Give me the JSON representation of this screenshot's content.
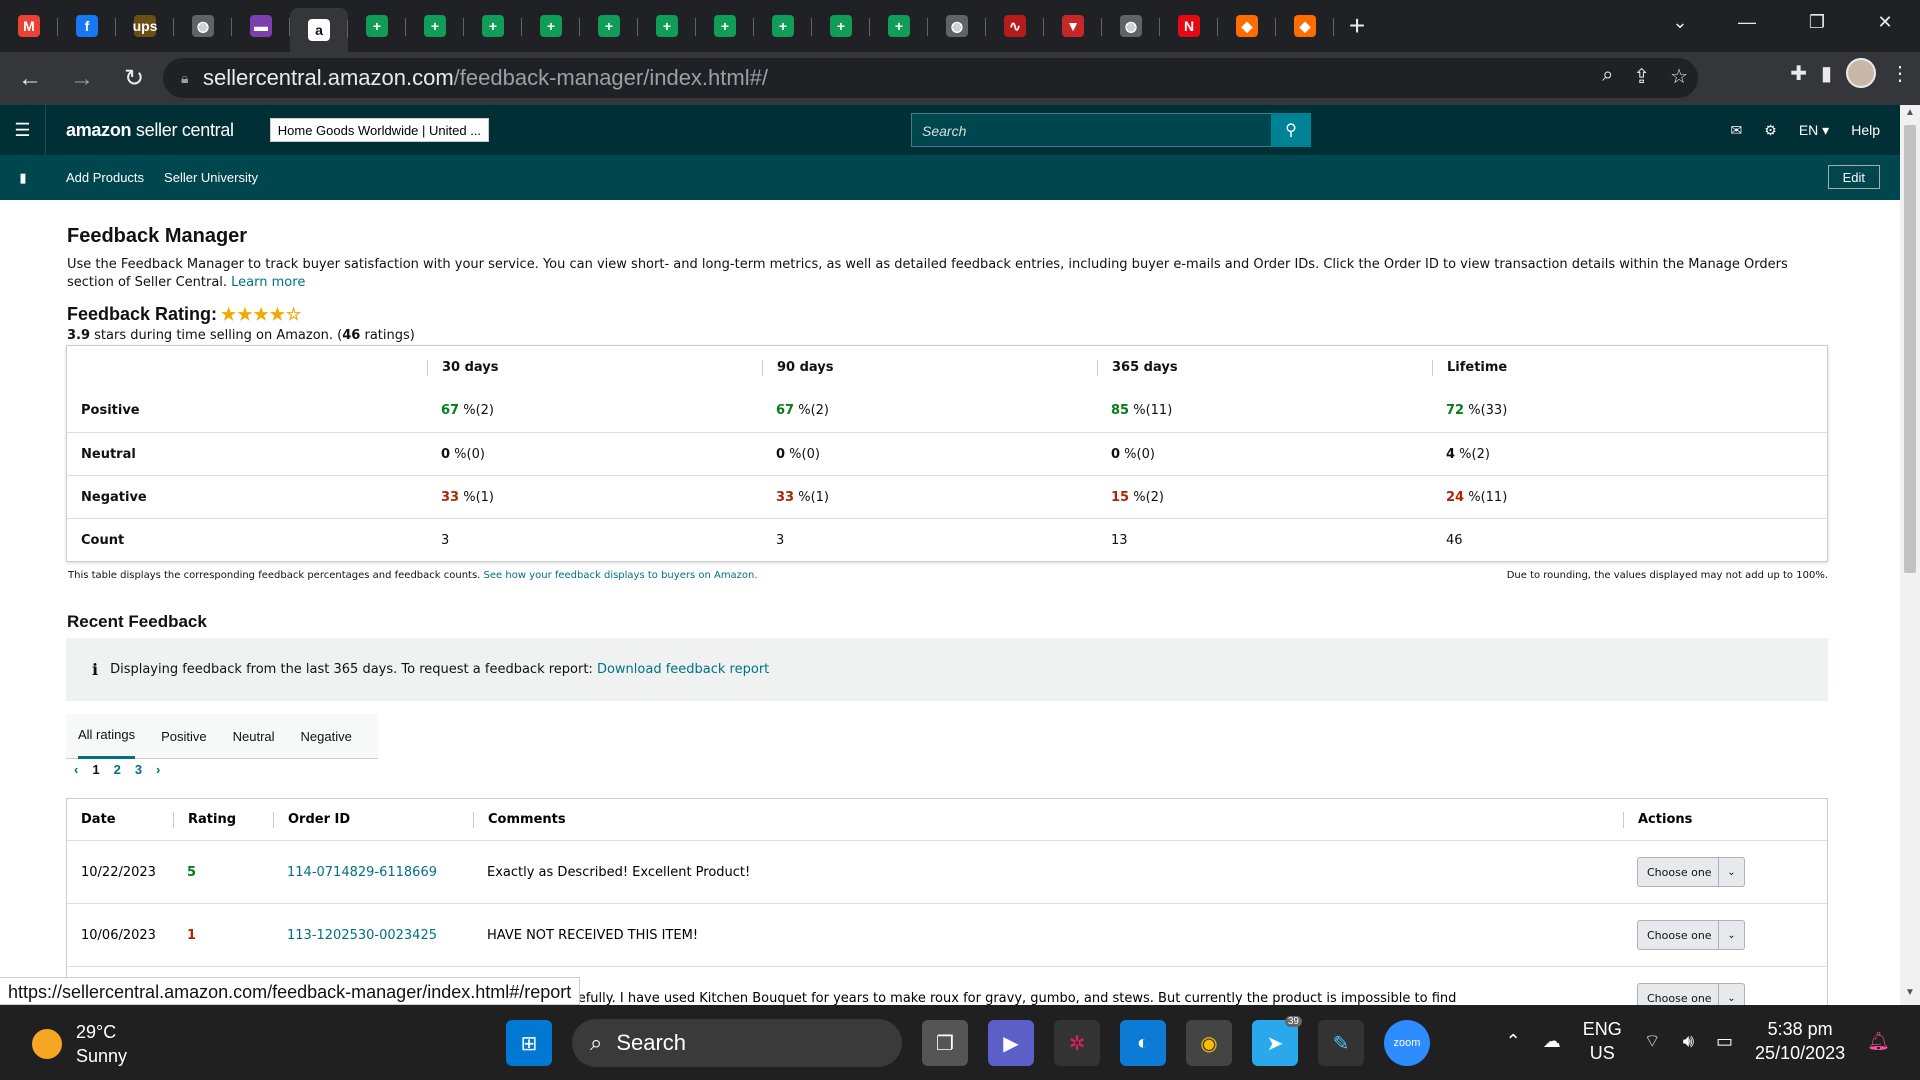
{
  "browser": {
    "tabs": [
      {
        "icon": "gmail-icon",
        "label": "M",
        "color": "#ea4335"
      },
      {
        "icon": "facebook-icon",
        "label": "f",
        "color": "#1877f2"
      },
      {
        "icon": "ups-icon",
        "label": "ups",
        "color": "#6b4e16"
      },
      {
        "icon": "globe-icon",
        "label": "◍",
        "color": "#5f6368"
      },
      {
        "icon": "site-icon",
        "label": "▬",
        "color": "#7b3fb0"
      },
      {
        "icon": "amazon-icon",
        "label": "a",
        "color": "#111111"
      },
      {
        "icon": "sheets-icon",
        "label": "+",
        "color": "#0f9d58"
      },
      {
        "icon": "sheets-icon",
        "label": "+",
        "color": "#0f9d58"
      },
      {
        "icon": "sheets-icon",
        "label": "+",
        "color": "#0f9d58"
      },
      {
        "icon": "sheets-icon",
        "label": "+",
        "color": "#0f9d58"
      },
      {
        "icon": "sheets-icon",
        "label": "+",
        "color": "#0f9d58"
      },
      {
        "icon": "sheets-icon",
        "label": "+",
        "color": "#0f9d58"
      },
      {
        "icon": "sheets-icon",
        "label": "+",
        "color": "#0f9d58"
      },
      {
        "icon": "sheets-icon",
        "label": "+",
        "color": "#0f9d58"
      },
      {
        "icon": "sheets-icon",
        "label": "+",
        "color": "#0f9d58"
      },
      {
        "icon": "sheets-icon",
        "label": "+",
        "color": "#0f9d58"
      },
      {
        "icon": "globe-icon",
        "label": "◍",
        "color": "#5f6368"
      },
      {
        "icon": "chart-icon",
        "label": "∿",
        "color": "#b71c1c"
      },
      {
        "icon": "site-icon",
        "label": "▼",
        "color": "#c62828"
      },
      {
        "icon": "globe-icon",
        "label": "◍",
        "color": "#5f6368"
      },
      {
        "icon": "netflix-icon",
        "label": "N",
        "color": "#e50914"
      },
      {
        "icon": "app-icon",
        "label": "◆",
        "color": "#ff6d00"
      },
      {
        "icon": "app-icon",
        "label": "◆",
        "color": "#ff6d00"
      }
    ],
    "url_host": "sellercentral.amazon.com",
    "url_path": "/feedback-manager/index.html#/",
    "status_url": "https://sellercentral.amazon.com/feedback-manager/index.html#/report"
  },
  "header": {
    "logo_bold": "amazon",
    "logo_rest": " seller central",
    "store": "Home Goods Worldwide | United ...",
    "search_placeholder": "Search",
    "lang": "EN ▾",
    "help": "Help"
  },
  "subnav": {
    "items": [
      "Add Products",
      "Seller University"
    ],
    "edit": "Edit"
  },
  "page": {
    "title": "Feedback Manager",
    "intro": "Use the Feedback Manager to track buyer satisfaction with your service. You can view short- and long-term metrics, as well as detailed feedback entries, including buyer e-mails and Order IDs. Click the Order ID to view transaction details within the Manage Orders section of Seller Central.",
    "learn_more": "Learn more",
    "rating_label": "Feedback Rating:",
    "rating_stars": 3.9,
    "rating_stars_glyph": "★★★★☆",
    "rating_value": "3.9",
    "rating_sub_mid": " stars during time selling on Amazon. (",
    "rating_count": "46",
    "rating_sub_end": " ratings)"
  },
  "metrics": {
    "headers": [
      "30 days",
      "90 days",
      "365 days",
      "Lifetime"
    ],
    "rows": [
      {
        "label": "Positive",
        "cells": [
          {
            "v": "67",
            "s": " %(2)"
          },
          {
            "v": "67",
            "s": " %(2)"
          },
          {
            "v": "85",
            "s": " %(11)"
          },
          {
            "v": "72",
            "s": " %(33)"
          }
        ]
      },
      {
        "label": "Neutral",
        "cells": [
          {
            "v": "0",
            "s": " %(0)"
          },
          {
            "v": "0",
            "s": " %(0)"
          },
          {
            "v": "0",
            "s": " %(0)"
          },
          {
            "v": "4",
            "s": " %(2)"
          }
        ]
      },
      {
        "label": "Negative",
        "cells": [
          {
            "v": "33",
            "s": " %(1)"
          },
          {
            "v": "33",
            "s": " %(1)"
          },
          {
            "v": "15",
            "s": " %(2)"
          },
          {
            "v": "24",
            "s": " %(11)"
          }
        ]
      },
      {
        "label": "Count",
        "cells": [
          {
            "v": "",
            "s": "3"
          },
          {
            "v": "",
            "s": "3"
          },
          {
            "v": "",
            "s": "13"
          },
          {
            "v": "",
            "s": "46"
          }
        ]
      }
    ],
    "foot_left": "This table displays the corresponding feedback percentages and feedback counts.",
    "foot_left_link": "See how your feedback displays to buyers on Amazon.",
    "foot_right": "Due to rounding, the values displayed may not add up to 100%."
  },
  "recent": {
    "title": "Recent Feedback",
    "info": "Displaying feedback from the last 365 days. To request a feedback report:",
    "info_link": "Download feedback report",
    "tabs": [
      "All ratings",
      "Positive",
      "Neutral",
      "Negative"
    ],
    "pages": [
      "1",
      "2",
      "3"
    ],
    "columns": [
      "Date",
      "Rating",
      "Order ID",
      "Comments",
      "Actions"
    ],
    "rows": [
      {
        "date": "10/22/2023",
        "rating": "5",
        "order": "114-0714829-6118669",
        "comment": "Exactly as Described! Excellent Product!",
        "action": "Choose one"
      },
      {
        "date": "10/06/2023",
        "rating": "1",
        "order": "113-1202530-0023425",
        "comment": "HAVE NOT RECEIVED THIS ITEM!",
        "action": "Choose one"
      },
      {
        "date": "",
        "rating": "",
        "order": "",
        "comment": "uickly and carefully. I have used Kitchen Bouquet for years to make roux for gravy, gumbo, and stews. But currently the product is impossible to find",
        "action": "Choose one"
      }
    ]
  },
  "taskbar": {
    "temp": "29°C",
    "weather": "Sunny",
    "search": "Search",
    "lang1": "ENG",
    "lang2": "US",
    "time": "5:38 pm",
    "date": "25/10/2023",
    "telegram_badge": "39"
  }
}
